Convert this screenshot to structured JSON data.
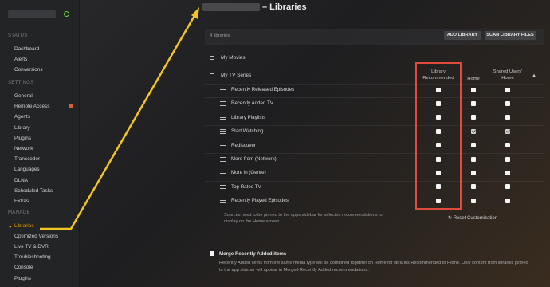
{
  "sidebar": {
    "sections": {
      "status": "STATUS",
      "settings": "SETTINGS",
      "manage": "MANAGE"
    },
    "status_items": [
      "Dashboard",
      "Alerts",
      "Conversions"
    ],
    "settings_items": [
      "General",
      "Remote Access",
      "Agents",
      "Library",
      "Plugins",
      "Network",
      "Transcoder",
      "Languages",
      "DLNA",
      "Scheduled Tasks",
      "Extras"
    ],
    "manage_items": [
      "Libraries",
      "Optimized Versions",
      "Live TV & DVR",
      "Troubleshooting",
      "Console",
      "Plugins"
    ],
    "active_item": "Libraries",
    "colors": {
      "accent": "#e5a00d",
      "server_status": "#6fcf3f",
      "alert": "#d9622c"
    }
  },
  "page": {
    "title_suffix": "– Libraries",
    "count": "4 libraries",
    "add_library": "ADD LIBRARY",
    "scan_files": "SCAN LIBRARY FILES"
  },
  "libraries": [
    {
      "name": "My Movies",
      "icon": "movie-icon"
    },
    {
      "name": "My TV Series",
      "icon": "tv-icon"
    }
  ],
  "columns": {
    "library_recommended": "Library Recommended",
    "home": "Home",
    "shared_home": "Shared Users' Home"
  },
  "recommendations": [
    {
      "name": "Recently Released Episodes",
      "library": false,
      "home": false,
      "shared": false
    },
    {
      "name": "Recently Added TV",
      "library": false,
      "home": false,
      "shared": false
    },
    {
      "name": "Library Playlists",
      "library": false,
      "home": false,
      "shared": false
    },
    {
      "name": "Start Watching",
      "library": false,
      "home": true,
      "shared": true
    },
    {
      "name": "Rediscover",
      "library": false,
      "home": false,
      "shared": false
    },
    {
      "name": "More from (Network)",
      "library": false,
      "home": false,
      "shared": false
    },
    {
      "name": "More in (Genre)",
      "library": false,
      "home": false,
      "shared": false
    },
    {
      "name": "Top Rated TV",
      "library": false,
      "home": false,
      "shared": false
    },
    {
      "name": "Recently Played Episodes",
      "library": false,
      "home": false,
      "shared": false
    }
  ],
  "note": "Sources need to be pinned to the apps sidebar for selected recommendations to display on the Home screen",
  "reset": "Reset Customization",
  "merge": {
    "label": "Merge Recently Added items",
    "checked": false,
    "description": "Recently Added items from the same media type will be combined together on Home for libraries Recommended to Home. Only content from libraries pinned to the app sidebar will appear in Merged Recently Added recommendations."
  },
  "annotation_colors": {
    "highlight_box": "#e14a3c",
    "arrow": "#f2c522"
  }
}
